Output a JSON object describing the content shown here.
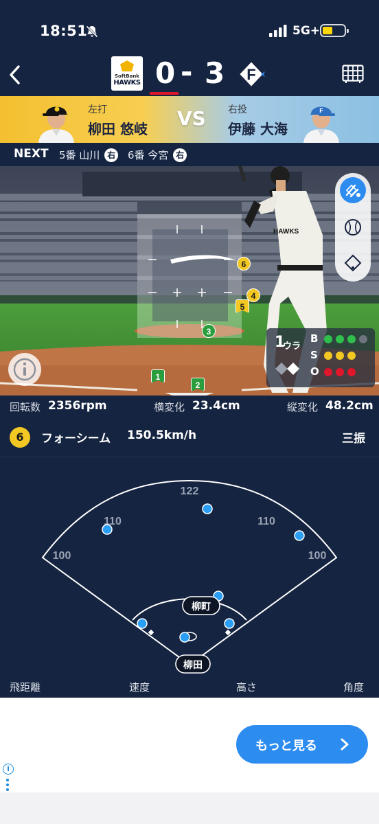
{
  "status_bar": {
    "time": "18:51",
    "network": "5G+"
  },
  "scoreboard": {
    "home_logo_top": "SoftBank",
    "home_logo_bottom": "HAWKS",
    "home_score": "0",
    "separator": "-",
    "away_score": "3",
    "away_logo_letter": "F"
  },
  "matchup": {
    "batter_label": "左打",
    "batter_name": "柳田 悠岐",
    "vs": "VS",
    "pitcher_label": "右投",
    "pitcher_name": "伊藤 大海"
  },
  "next": {
    "label": "NEXT",
    "batters": [
      {
        "text": "5番 山川",
        "hand": "右"
      },
      {
        "text": "6番 今宮",
        "hand": "右"
      }
    ]
  },
  "field": {
    "pitches": [
      {
        "num": "1",
        "kind": "flag-green"
      },
      {
        "num": "2",
        "kind": "flag-green"
      },
      {
        "num": "3",
        "kind": "green"
      },
      {
        "num": "4",
        "kind": "yellow"
      },
      {
        "num": "5",
        "kind": "yellow-flag"
      },
      {
        "num": "6",
        "kind": "yellow"
      }
    ],
    "count": {
      "outs": "1",
      "half": "ウラ",
      "balls_label": "B",
      "strikes_label": "S",
      "outs_label": "O",
      "balls": 3,
      "strikes": 3,
      "outs_count": 3
    },
    "colors": {
      "ball": "#2ec04a",
      "strike": "#f3c823",
      "out": "#e0162b"
    }
  },
  "pitch_stats": {
    "spin_label": "回転数",
    "spin_value": "2356rpm",
    "hbreak_label": "横変化",
    "hbreak_value": "23.4cm",
    "vbreak_label": "縦変化",
    "vbreak_value": "48.2cm"
  },
  "pitch": {
    "number": "6",
    "type": "フォーシーム",
    "speed": "150.5km/h",
    "result": "三振"
  },
  "diamond": {
    "distances": {
      "center": "122",
      "left_center": "110",
      "right_center": "110",
      "left": "100",
      "right": "100"
    },
    "runner_label": "柳町",
    "batter_label": "柳田"
  },
  "hit_stats": {
    "distance_label": "飛距離",
    "speed_label": "速度",
    "height_label": "高さ",
    "angle_label": "角度"
  },
  "more_button": {
    "label": "もっと見る"
  },
  "colors": {
    "navy": "#152440",
    "accent_blue": "#2d8cf0",
    "hawks_yellow": "#f3c823",
    "fighters_blue": "#1a66b3"
  }
}
